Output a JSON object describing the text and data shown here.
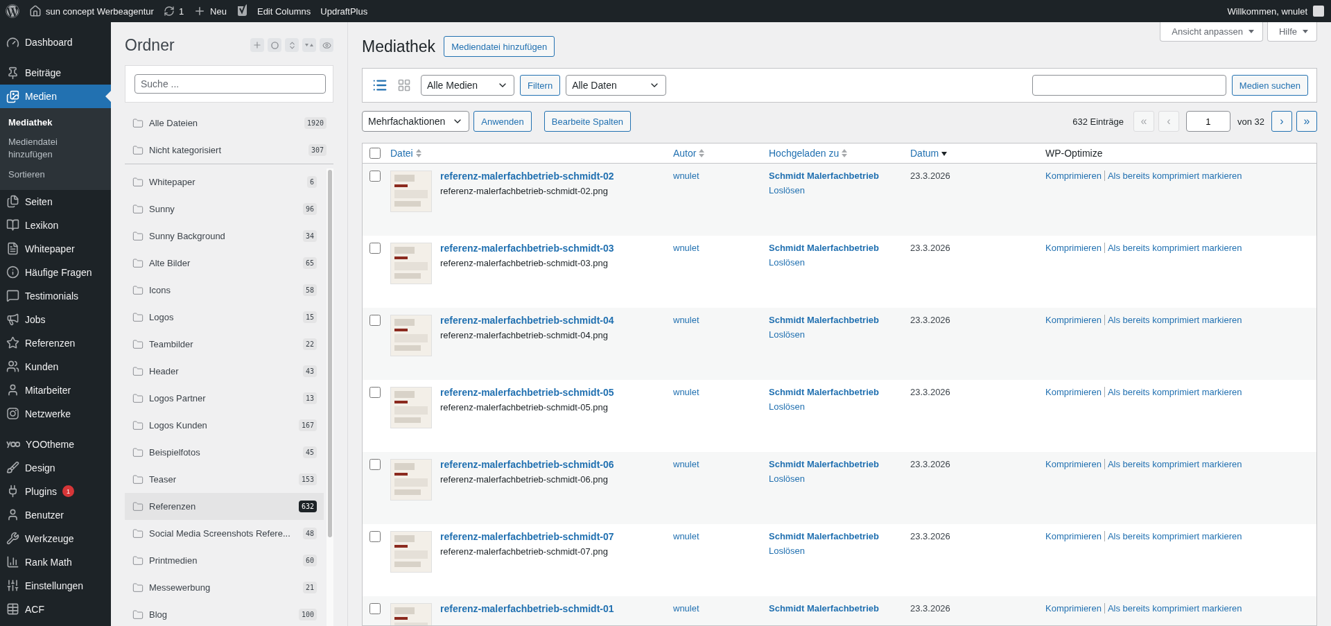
{
  "admin_bar": {
    "site": "sun concept Werbeagentur",
    "updates": "1",
    "new": "Neu",
    "links": [
      "Edit Columns",
      "UpdraftPlus"
    ],
    "greeting": "Willkommen, wnulet"
  },
  "menu": [
    {
      "items": [
        {
          "label": "Dashboard",
          "selected": false
        }
      ]
    },
    {
      "items": [
        {
          "label": "Beiträge",
          "selected": false
        },
        {
          "label": "Medien",
          "selected": true,
          "children": [
            {
              "label": "Mediathek",
              "selected": true
            },
            {
              "label": "Mediendatei hinzufügen",
              "selected": false
            },
            {
              "label": "Sortieren",
              "selected": false
            }
          ]
        },
        {
          "label": "Seiten",
          "selected": false
        },
        {
          "label": "Lexikon",
          "selected": false
        },
        {
          "label": "Whitepaper",
          "selected": false
        },
        {
          "label": "Häufige Fragen",
          "selected": false
        },
        {
          "label": "Testimonials",
          "selected": false
        },
        {
          "label": "Jobs",
          "selected": false
        },
        {
          "label": "Referenzen",
          "selected": false
        },
        {
          "label": "Kunden",
          "selected": false
        },
        {
          "label": "Mitarbeiter",
          "selected": false
        },
        {
          "label": "Netzwerke",
          "selected": false
        }
      ]
    },
    {
      "items": [
        {
          "label": "YOOtheme",
          "selected": false
        },
        {
          "label": "Design",
          "selected": false
        },
        {
          "label": "Plugins",
          "selected": false,
          "badge": "1"
        },
        {
          "label": "Benutzer",
          "selected": false
        },
        {
          "label": "Werkzeuge",
          "selected": false
        },
        {
          "label": "Rank Math",
          "selected": false
        },
        {
          "label": "Einstellungen",
          "selected": false
        },
        {
          "label": "ACF",
          "selected": false
        }
      ]
    }
  ],
  "folders": {
    "title": "Ordner",
    "search_placeholder": "Suche ...",
    "pinned": [
      {
        "name": "Alle Dateien",
        "count": "1920",
        "selected": false
      },
      {
        "name": "Nicht kategorisiert",
        "count": "307",
        "selected": false
      }
    ],
    "items": [
      {
        "name": "Whitepaper",
        "count": "6",
        "selected": false
      },
      {
        "name": "Sunny",
        "count": "96",
        "selected": false
      },
      {
        "name": "Sunny Background",
        "count": "34",
        "selected": false
      },
      {
        "name": "Alte Bilder",
        "count": "65",
        "selected": false
      },
      {
        "name": "Icons",
        "count": "58",
        "selected": false
      },
      {
        "name": "Logos",
        "count": "15",
        "selected": false
      },
      {
        "name": "Teambilder",
        "count": "22",
        "selected": false
      },
      {
        "name": "Header",
        "count": "43",
        "selected": false
      },
      {
        "name": "Logos Partner",
        "count": "13",
        "selected": false
      },
      {
        "name": "Logos Kunden",
        "count": "167",
        "selected": false
      },
      {
        "name": "Beispielfotos",
        "count": "45",
        "selected": false
      },
      {
        "name": "Teaser",
        "count": "153",
        "selected": false
      },
      {
        "name": "Referenzen",
        "count": "632",
        "selected": true
      },
      {
        "name": "Social Media Screenshots Refere...",
        "count": "48",
        "selected": false
      },
      {
        "name": "Printmedien",
        "count": "60",
        "selected": false
      },
      {
        "name": "Messewerbung",
        "count": "21",
        "selected": false
      },
      {
        "name": "Blog",
        "count": "100",
        "selected": false
      }
    ]
  },
  "page": {
    "title": "Mediathek",
    "add_button": "Mediendatei hinzufügen",
    "screen_tabs": [
      "Ansicht anpassen",
      "Hilfe"
    ]
  },
  "filters": {
    "view_modes": [
      {
        "kind": "list",
        "selected": true
      },
      {
        "kind": "grid",
        "selected": false
      }
    ],
    "type_select": "Alle Medien",
    "filter_button": "Filtern",
    "date_select": "Alle Daten",
    "search_button": "Medien suchen"
  },
  "bulk": {
    "select": "Mehrfachaktionen",
    "apply": "Anwenden",
    "edit_columns": "Bearbeite Spalten"
  },
  "pagination": {
    "count": "632 Einträge",
    "back": [
      {
        "label": "«",
        "disabled": true
      },
      {
        "label": "‹",
        "disabled": true
      }
    ],
    "page": "1",
    "of": "von 32",
    "forward": [
      {
        "label": "›",
        "disabled": false
      },
      {
        "label": "»",
        "disabled": false
      }
    ]
  },
  "table": {
    "select_all_checked": false,
    "columns": [
      {
        "label": "Datei",
        "sortable": true,
        "sorted": false
      },
      {
        "label": "Autor",
        "sortable": true,
        "sorted": false
      },
      {
        "label": "Hochgeladen zu",
        "sortable": true,
        "sorted": false
      },
      {
        "label": "Datum",
        "sortable": true,
        "sorted": true
      },
      {
        "label": "WP-Optimize",
        "sortable": false,
        "sorted": false
      }
    ],
    "rows": [
      {
        "checked": false,
        "title": "referenz-malerfachbetrieb-schmidt-02",
        "file": "referenz-malerfachbetrieb-schmidt-02.png",
        "author": "wnulet",
        "attached_to": "Schmidt Malerfachbetrieb",
        "detach": "Loslösen",
        "date": "23.3.2026",
        "actions": [
          "Komprimieren",
          "Als bereits komprimiert markieren"
        ]
      },
      {
        "checked": false,
        "title": "referenz-malerfachbetrieb-schmidt-03",
        "file": "referenz-malerfachbetrieb-schmidt-03.png",
        "author": "wnulet",
        "attached_to": "Schmidt Malerfachbetrieb",
        "detach": "Loslösen",
        "date": "23.3.2026",
        "actions": [
          "Komprimieren",
          "Als bereits komprimiert markieren"
        ]
      },
      {
        "checked": false,
        "title": "referenz-malerfachbetrieb-schmidt-04",
        "file": "referenz-malerfachbetrieb-schmidt-04.png",
        "author": "wnulet",
        "attached_to": "Schmidt Malerfachbetrieb",
        "detach": "Loslösen",
        "date": "23.3.2026",
        "actions": [
          "Komprimieren",
          "Als bereits komprimiert markieren"
        ]
      },
      {
        "checked": false,
        "title": "referenz-malerfachbetrieb-schmidt-05",
        "file": "referenz-malerfachbetrieb-schmidt-05.png",
        "author": "wnulet",
        "attached_to": "Schmidt Malerfachbetrieb",
        "detach": "Loslösen",
        "date": "23.3.2026",
        "actions": [
          "Komprimieren",
          "Als bereits komprimiert markieren"
        ]
      },
      {
        "checked": false,
        "title": "referenz-malerfachbetrieb-schmidt-06",
        "file": "referenz-malerfachbetrieb-schmidt-06.png",
        "author": "wnulet",
        "attached_to": "Schmidt Malerfachbetrieb",
        "detach": "Loslösen",
        "date": "23.3.2026",
        "actions": [
          "Komprimieren",
          "Als bereits komprimiert markieren"
        ]
      },
      {
        "checked": false,
        "title": "referenz-malerfachbetrieb-schmidt-07",
        "file": "referenz-malerfachbetrieb-schmidt-07.png",
        "author": "wnulet",
        "attached_to": "Schmidt Malerfachbetrieb",
        "detach": "Loslösen",
        "date": "23.3.2026",
        "actions": [
          "Komprimieren",
          "Als bereits komprimiert markieren"
        ]
      },
      {
        "checked": false,
        "title": "referenz-malerfachbetrieb-schmidt-01",
        "author": "wnulet",
        "attached_to": "Schmidt Malerfachbetrieb",
        "date": "23.3.2026",
        "actions": [
          "Komprimieren",
          "Als bereits komprimiert markieren"
        ]
      }
    ]
  }
}
